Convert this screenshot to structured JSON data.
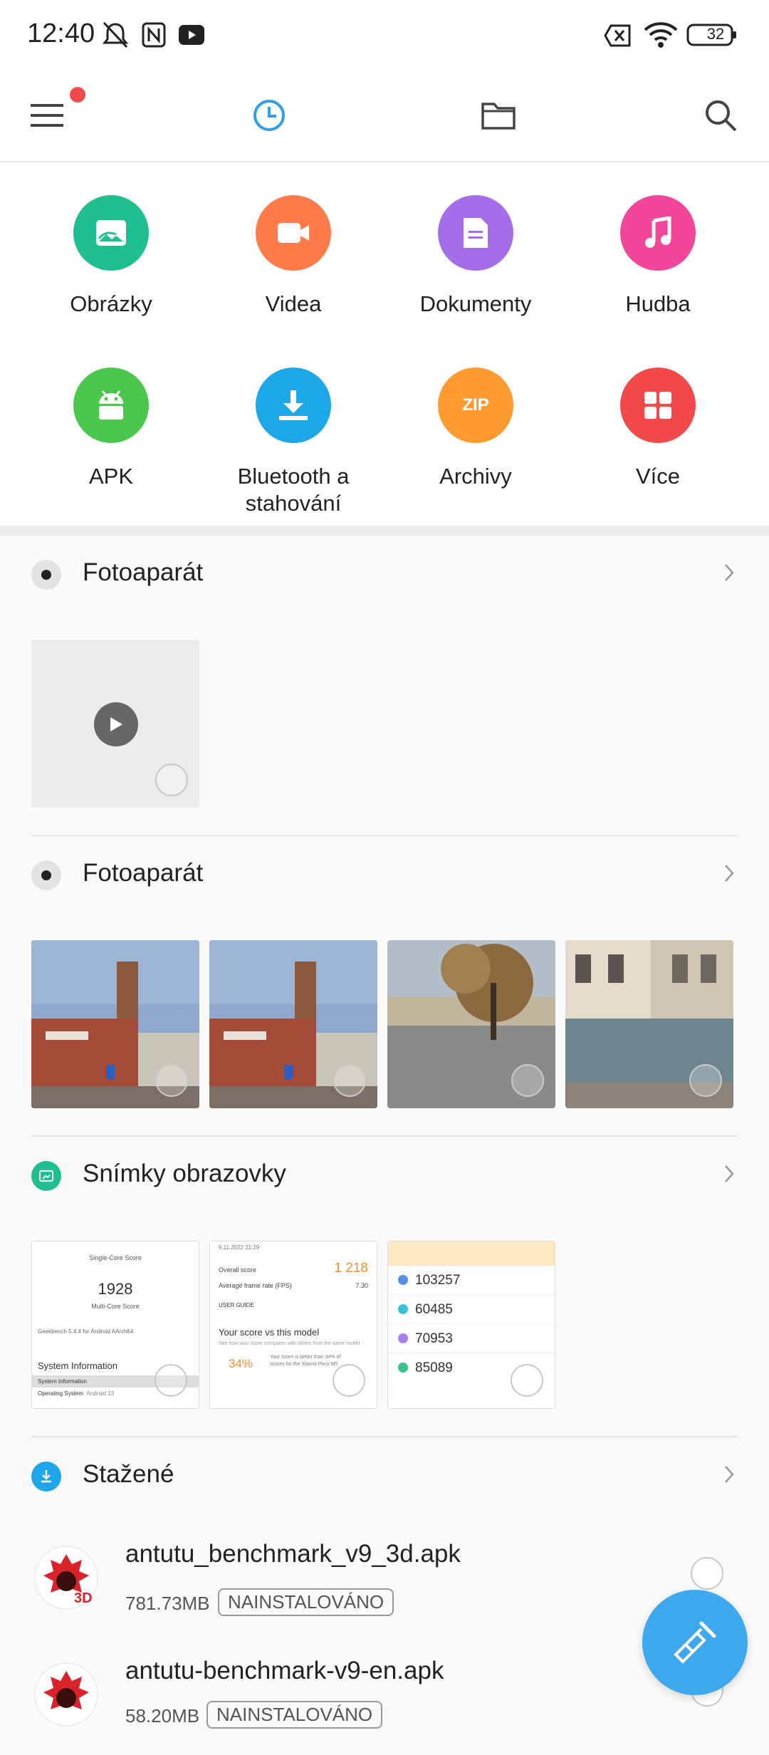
{
  "status": {
    "time": "12:40",
    "battery": "32"
  },
  "nav": {
    "menu_icon": "hamburger-menu-icon",
    "recent_icon": "clock-icon",
    "folder_icon": "folder-icon",
    "search_icon": "search-icon",
    "accent": "#2aa0e6"
  },
  "categories": [
    {
      "label": "Obrázky",
      "icon": "image-icon",
      "color": "#1fbf8f"
    },
    {
      "label": "Videa",
      "icon": "video-icon",
      "color": "#ff7b4a"
    },
    {
      "label": "Dokumenty",
      "icon": "document-icon",
      "color": "#a46ee8"
    },
    {
      "label": "Hudba",
      "icon": "music-icon",
      "color": "#f2469a"
    },
    {
      "label": "APK",
      "icon": "android-icon",
      "color": "#4cc74e"
    },
    {
      "label": "Bluetooth a stahování",
      "icon": "download-icon",
      "color": "#1ea7e8"
    },
    {
      "label": "Archivy",
      "icon": "zip-icon",
      "color": "#ff9a2e",
      "icon_text": "ZIP"
    },
    {
      "label": "Více",
      "icon": "grid-icon",
      "color": "#f24a4a"
    }
  ],
  "sections": [
    {
      "title": "Fotoaparát",
      "icon": "camera-dot-icon"
    },
    {
      "title": "Fotoaparát",
      "icon": "camera-dot-icon"
    },
    {
      "title": "Snímky obrazovky",
      "icon": "screenshot-icon",
      "color": "#1fbf8f"
    },
    {
      "title": "Stažené",
      "icon": "download-icon",
      "color": "#1ea7e8"
    }
  ],
  "screenshots": {
    "s1": {
      "top": "Single-Core Score",
      "score": "1928",
      "sub": "Multi-Core Score",
      "line": "Geekbench 5.4.4 for Android AArch64",
      "heading": "System Information",
      "row1": "System Information",
      "row2": "Operating System",
      "row2val": "Android 13"
    },
    "s2": {
      "date": "9.11.2022 21:29",
      "overall": "Overall score",
      "overall_val": "1 218",
      "fps": "Average frame rate (FPS)",
      "fps_val": "7.30",
      "guide": "USER GUIDE",
      "vs": "Your score vs this model",
      "vs_sub": "See how your score compares with others from the same model",
      "pct": "34%",
      "pct_text": "Your score is better than 34% of scores for the Xiaomi Poco M5"
    },
    "s3": {
      "scores": [
        "103257",
        "60485",
        "70953",
        "85089"
      ]
    }
  },
  "files": [
    {
      "name": "antutu_benchmark_v9_3d.apk",
      "size": "781.73MB",
      "badge": "NAINSTALOVÁNO"
    },
    {
      "name": "antutu-benchmark-v9-en.apk",
      "size": "58.20MB",
      "badge": "NAINSTALOVÁNO"
    }
  ],
  "fab": {
    "icon": "broom-clean-icon"
  }
}
